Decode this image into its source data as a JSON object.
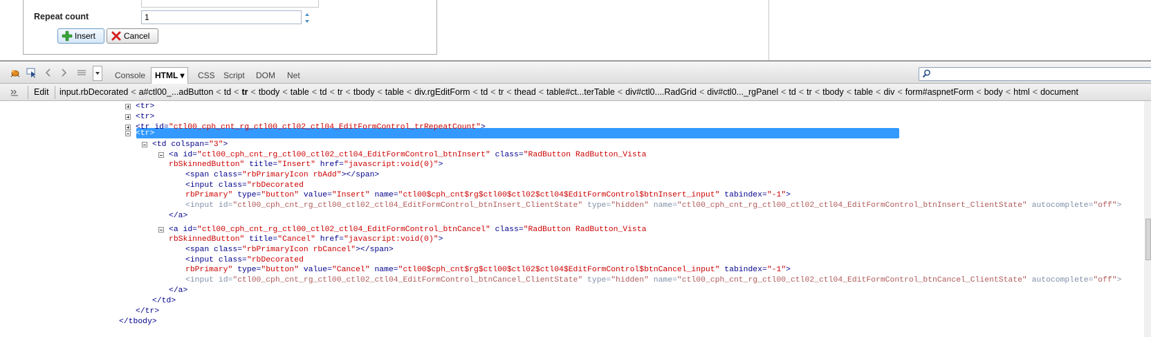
{
  "form": {
    "repeat_label": "Repeat count",
    "repeat_value": "1",
    "insert_label": "Insert",
    "cancel_label": "Cancel"
  },
  "toolbar": {
    "tabs": [
      {
        "label": "Console",
        "active": false
      },
      {
        "label": "HTML ▾",
        "active": true
      },
      {
        "label": "CSS",
        "active": false
      },
      {
        "label": "Script",
        "active": false
      },
      {
        "label": "DOM",
        "active": false
      },
      {
        "label": "Net",
        "active": false
      }
    ],
    "icons": [
      "inspect-firebug-icon",
      "inspect-element-icon",
      "back-icon",
      "forward-icon",
      "list-icon",
      "dropdown-icon",
      "search-icon"
    ]
  },
  "breadcrumb": {
    "edit_label": "Edit",
    "items": [
      "input.rbDecorated",
      "a#ctl00_...adButton",
      "td",
      "tr",
      "tbody",
      "table",
      "td",
      "tr",
      "tbody",
      "table",
      "div.rgEditForm",
      "td",
      "tr",
      "thead",
      "table#ct...terTable",
      "div#ctl0....RadGrid",
      "div#ctl0..._rgPanel",
      "td",
      "tr",
      "tbody",
      "table",
      "div",
      "form#aspnetForm",
      "body",
      "html",
      "document"
    ],
    "current_index": 3
  },
  "tree": {
    "l1": "<tr>",
    "l2": "<tr>",
    "l3": {
      "tag": "<tr ",
      "a1": "id=",
      "v1": "\"ctl00_cph_cnt_rg_ctl00_ctl02_ctl04_EditFormControl_trRepeatCount\"",
      "end": ">"
    },
    "l4": "<tr>",
    "l5": {
      "tag": "<td ",
      "a1": "colspan=",
      "v1": "\"3\"",
      "end": ">"
    },
    "l6": {
      "tag": "<a ",
      "a1": "id=",
      "v1": "\"ctl00_cph_cnt_rg_ctl00_ctl02_ctl04_EditFormControl_btnInsert\"",
      "a2": " class=",
      "v2": "\"RadButton RadButton_Vista"
    },
    "l7": {
      "v2": "rbSkinnedButton\"",
      "a3": " title=",
      "v3": "\"Insert\"",
      "a4": " href=",
      "v4": "\"javascript:void(0)\"",
      "end": ">"
    },
    "l8": {
      "tag": "<span ",
      "a1": "class=",
      "v1": "\"rbPrimaryIcon rbAdd\"",
      "end": "></span>"
    },
    "l9": {
      "tag": "<input ",
      "a1": "class=",
      "v1": "\"rbDecorated"
    },
    "l10": {
      "v1": "rbPrimary\"",
      "a2": " type=",
      "v2": "\"button\"",
      "a3": " value=",
      "v3": "\"Insert\"",
      "a4": " name=",
      "v4": "\"ctl00$cph_cnt$rg$ctl00$ctl02$ctl04$EditFormControl$btnInsert_input\"",
      "a5": " tabindex=",
      "v5": "\"-1\"",
      "end": ">"
    },
    "l11": {
      "tag": "<input ",
      "a1": "id=",
      "v1": "\"ctl00_cph_cnt_rg_ctl00_ctl02_ctl04_EditFormControl_btnInsert_ClientState\"",
      "a2": " type=",
      "v2": "\"hidden\"",
      "a3": " name=",
      "v3": "\"ctl00_cph_cnt_rg_ctl00_ctl02_ctl04_EditFormControl_btnInsert_ClientState\"",
      "a4": " autocomplete=",
      "v4": "\"off\"",
      "end": ">"
    },
    "l12": "</a>",
    "l13": {
      "tag": "<a ",
      "a1": "id=",
      "v1": "\"ctl00_cph_cnt_rg_ctl00_ctl02_ctl04_EditFormControl_btnCancel\"",
      "a2": " class=",
      "v2": "\"RadButton RadButton_Vista"
    },
    "l14": {
      "v2": "rbSkinnedButton\"",
      "a3": " title=",
      "v3": "\"Cancel\"",
      "a4": " href=",
      "v4": "\"javascript:void(0)\"",
      "end": ">"
    },
    "l15": {
      "tag": "<span ",
      "a1": "class=",
      "v1": "\"rbPrimaryIcon rbCancel\"",
      "end": "></span>"
    },
    "l16": {
      "tag": "<input ",
      "a1": "class=",
      "v1": "\"rbDecorated"
    },
    "l17": {
      "v1": "rbPrimary\"",
      "a2": " type=",
      "v2": "\"button\"",
      "a3": " value=",
      "v3": "\"Cancel\"",
      "a4": " name=",
      "v4": "\"ctl00$cph_cnt$rg$ctl00$ctl02$ctl04$EditFormControl$btnCancel_input\"",
      "a5": " tabindex=",
      "v5": "\"-1\"",
      "end": ">"
    },
    "l18": {
      "tag": "<input ",
      "a1": "id=",
      "v1": "\"ctl00_cph_cnt_rg_ctl00_ctl02_ctl04_EditFormControl_btnCancel_ClientState\"",
      "a2": " type=",
      "v2": "\"hidden\"",
      "a3": " name=",
      "v3": "\"ctl00_cph_cnt_rg_ctl00_ctl02_ctl04_EditFormControl_btnCancel_ClientState\"",
      "a4": " autocomplete=",
      "v4": "\"off\"",
      "end": ">"
    },
    "l19": "</a>",
    "l20": "</td>",
    "l21": "</tr>",
    "l22": "</tbody>"
  },
  "colors": {
    "selection": "#3399ff",
    "tag": "#00008b",
    "attr_value": "#cc0000"
  }
}
